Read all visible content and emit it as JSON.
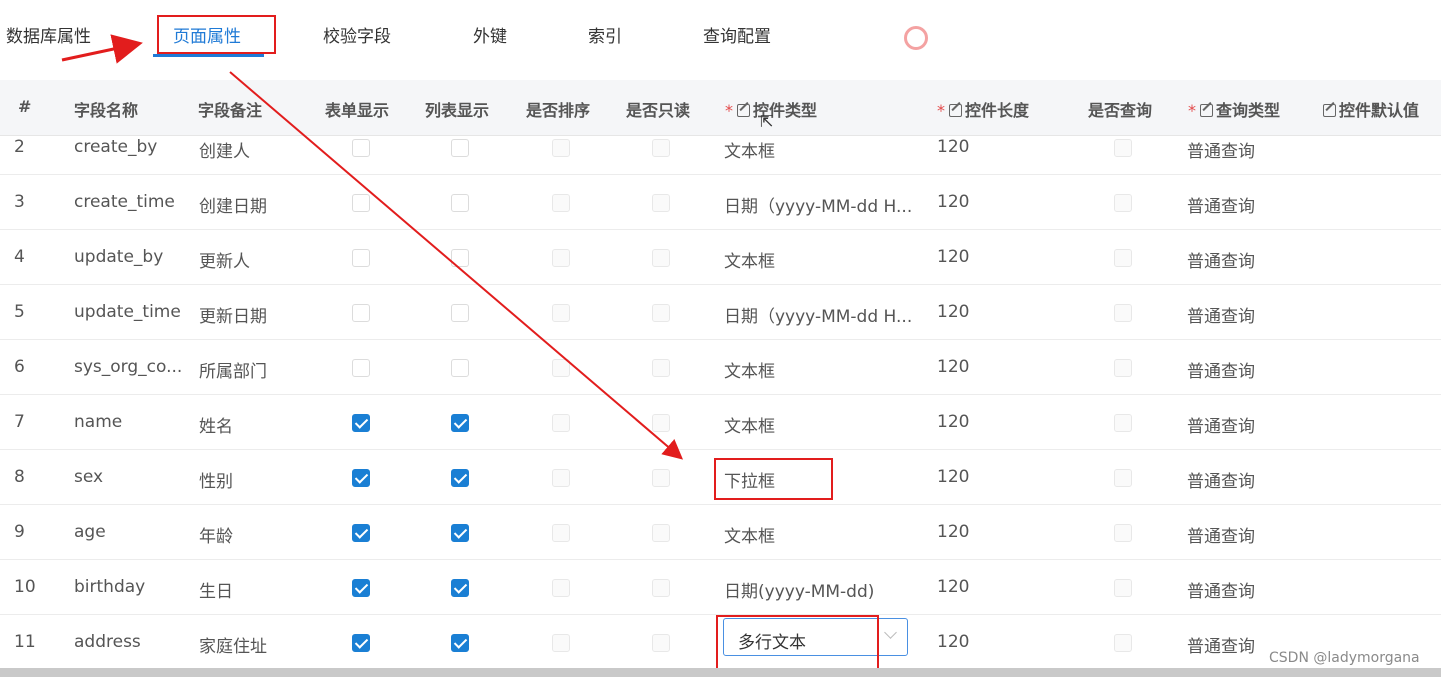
{
  "tabs": [
    {
      "label": "数据库属性"
    },
    {
      "label": "页面属性"
    },
    {
      "label": "校验字段"
    },
    {
      "label": "外键"
    },
    {
      "label": "索引"
    },
    {
      "label": "查询配置"
    }
  ],
  "active_tab": "页面属性",
  "table": {
    "headers": {
      "num": "#",
      "field_name": "字段名称",
      "field_remark": "字段备注",
      "form_show": "表单显示",
      "list_show": "列表显示",
      "sortable": "是否排序",
      "readonly": "是否只读",
      "control_type": "控件类型",
      "control_length": "控件长度",
      "is_query": "是否查询",
      "query_type": "查询类型",
      "default_value": "控件默认值"
    },
    "required_mark": "*",
    "rows": [
      {
        "num": "2",
        "name": "create_by",
        "remark": "创建人",
        "form": false,
        "list": false,
        "sort": false,
        "readonly": false,
        "control": "文本框",
        "length": "120",
        "query": false,
        "qtype": "普通查询"
      },
      {
        "num": "3",
        "name": "create_time",
        "remark": "创建日期",
        "form": false,
        "list": false,
        "sort": false,
        "readonly": false,
        "control": "日期（yyyy-MM-dd H...",
        "length": "120",
        "query": false,
        "qtype": "普通查询"
      },
      {
        "num": "4",
        "name": "update_by",
        "remark": "更新人",
        "form": false,
        "list": false,
        "sort": false,
        "readonly": false,
        "control": "文本框",
        "length": "120",
        "query": false,
        "qtype": "普通查询"
      },
      {
        "num": "5",
        "name": "update_time",
        "remark": "更新日期",
        "form": false,
        "list": false,
        "sort": false,
        "readonly": false,
        "control": "日期（yyyy-MM-dd H...",
        "length": "120",
        "query": false,
        "qtype": "普通查询"
      },
      {
        "num": "6",
        "name": "sys_org_co...",
        "remark": "所属部门",
        "form": false,
        "list": false,
        "sort": false,
        "readonly": false,
        "control": "文本框",
        "length": "120",
        "query": false,
        "qtype": "普通查询"
      },
      {
        "num": "7",
        "name": "name",
        "remark": "姓名",
        "form": true,
        "list": true,
        "sort": false,
        "readonly": false,
        "control": "文本框",
        "length": "120",
        "query": false,
        "qtype": "普通查询"
      },
      {
        "num": "8",
        "name": "sex",
        "remark": "性别",
        "form": true,
        "list": true,
        "sort": false,
        "readonly": false,
        "control": "下拉框",
        "length": "120",
        "query": false,
        "qtype": "普通查询"
      },
      {
        "num": "9",
        "name": "age",
        "remark": "年龄",
        "form": true,
        "list": true,
        "sort": false,
        "readonly": false,
        "control": "文本框",
        "length": "120",
        "query": false,
        "qtype": "普通查询"
      },
      {
        "num": "10",
        "name": "birthday",
        "remark": "生日",
        "form": true,
        "list": true,
        "sort": false,
        "readonly": false,
        "control": "日期(yyyy-MM-dd)",
        "length": "120",
        "query": false,
        "qtype": "普通查询"
      },
      {
        "num": "11",
        "name": "address",
        "remark": "家庭住址",
        "form": true,
        "list": true,
        "sort": false,
        "readonly": false,
        "control": "多行文本",
        "control_is_select": true,
        "length": "120",
        "query": false,
        "qtype": "普通查询"
      }
    ]
  },
  "watermark": "CSDN @ladymorgana",
  "colors": {
    "accent": "#1a7fd4",
    "annotation_red": "#e21d1d"
  }
}
